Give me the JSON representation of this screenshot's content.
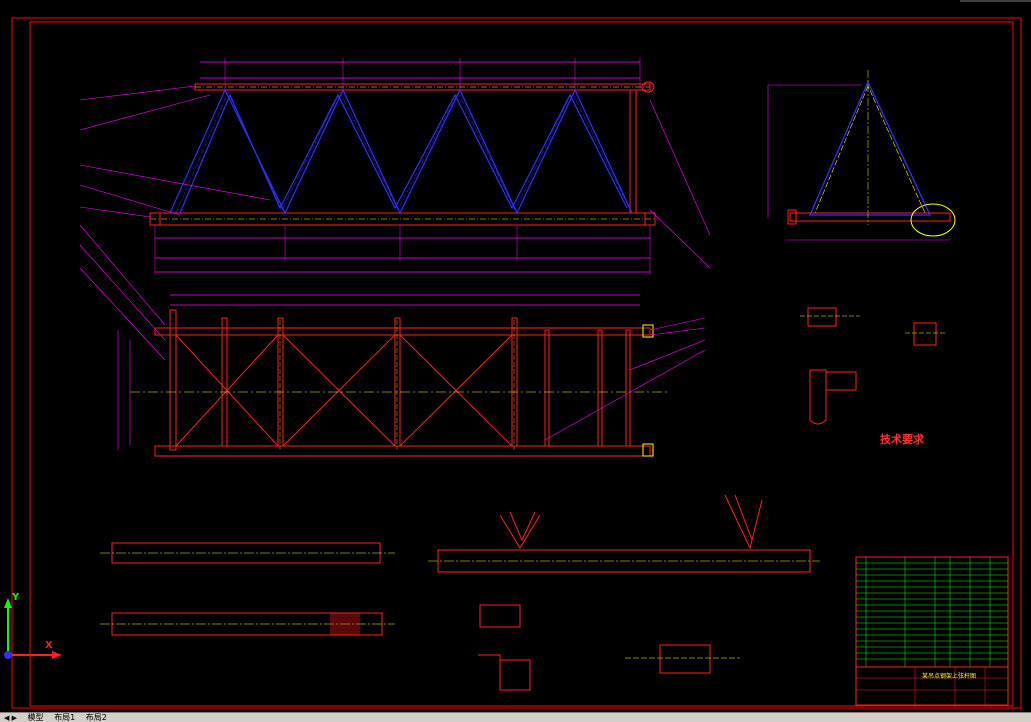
{
  "app": {
    "name": "AutoCAD drawing viewport"
  },
  "drawing": {
    "technical_requirements_title": "技术要求",
    "title_block_caption": "某吊点钢架上弦杆图",
    "colors": {
      "background": "#000000",
      "border": "#ff0000",
      "truss": "#3030ff",
      "dimension": "#ff00ff",
      "centerline": "#ffff00",
      "detail": "#00ffff",
      "table_grid": "#00ff00"
    }
  },
  "ucs": {
    "x_label": "X",
    "y_label": "Y"
  },
  "layout_tabs": {
    "nav": "◀ ▶",
    "items": [
      {
        "label": "模型",
        "active": true
      },
      {
        "label": "布局1",
        "active": false
      },
      {
        "label": "布局2",
        "active": false
      }
    ]
  }
}
